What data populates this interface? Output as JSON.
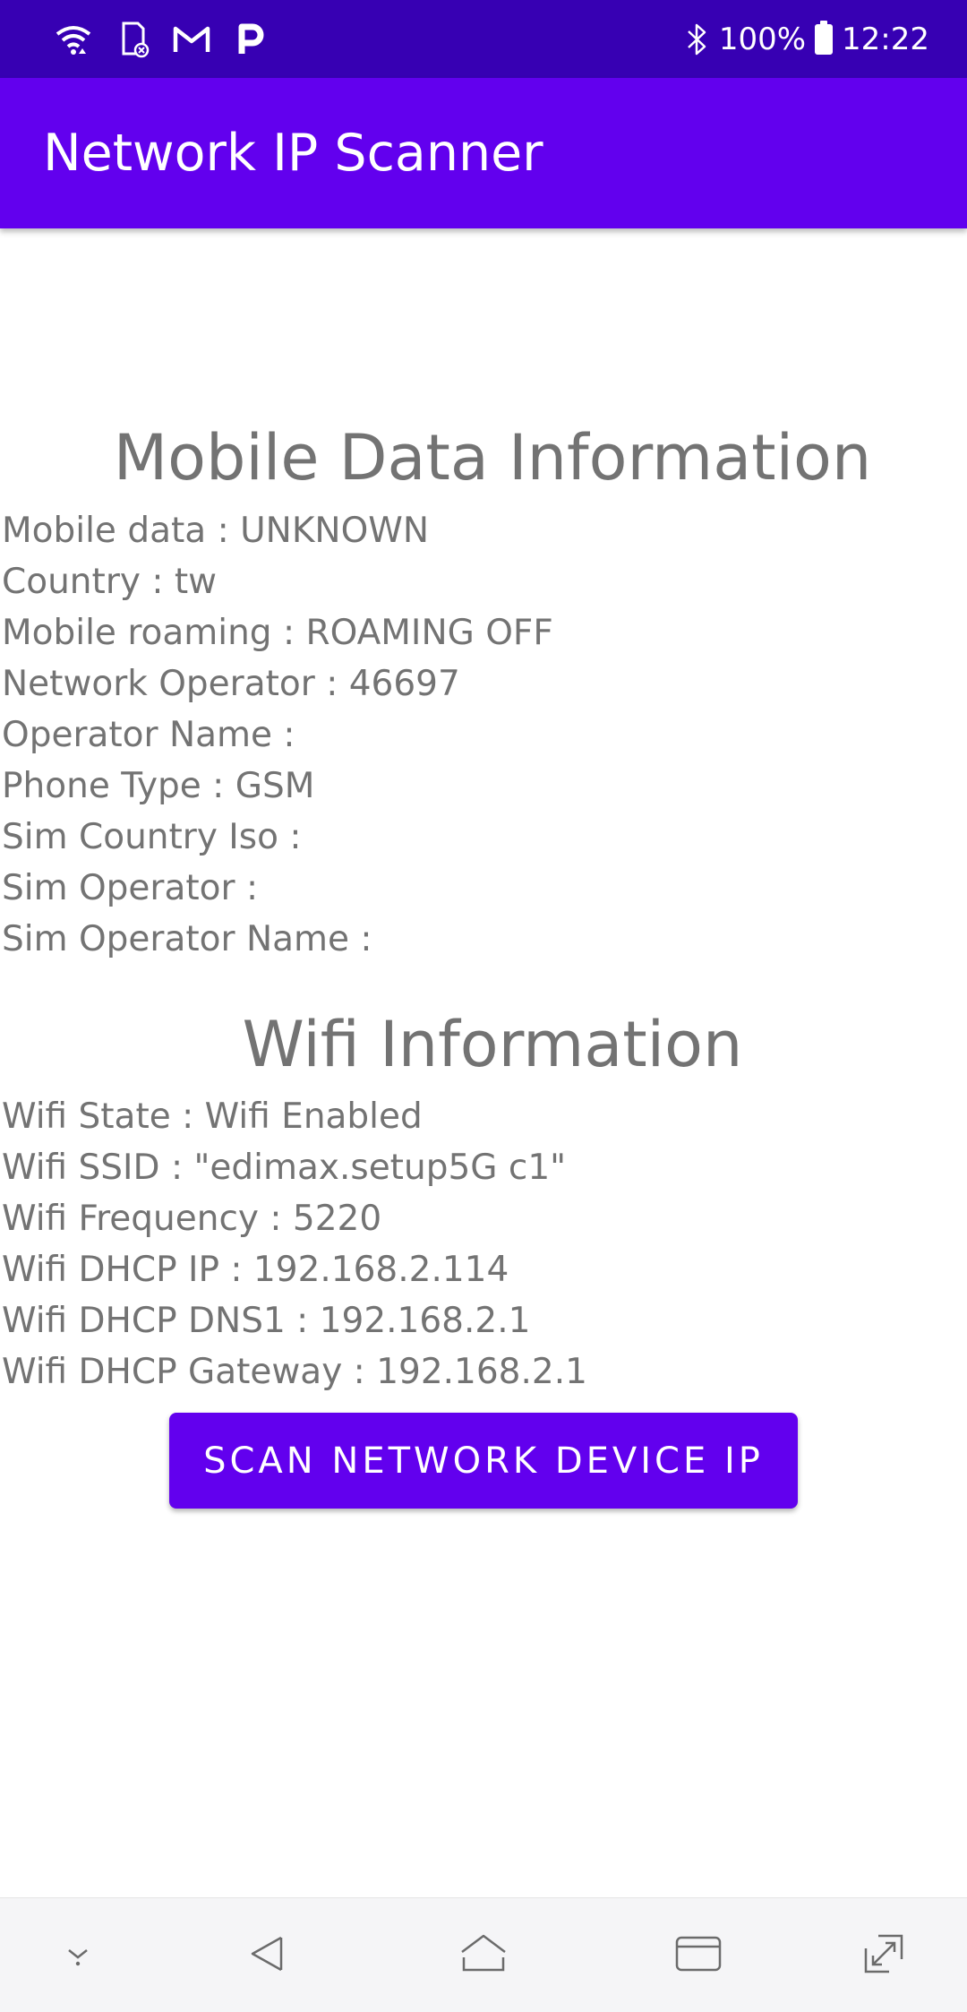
{
  "status_bar": {
    "battery_text": "100%",
    "time": "12:22",
    "icons": [
      "wifi-icon",
      "sd-card-icon",
      "gmail-icon",
      "p-app-icon",
      "bluetooth-icon",
      "battery-icon"
    ]
  },
  "app_bar": {
    "title": "Network IP Scanner"
  },
  "mobile_section": {
    "title": "Mobile Data Information",
    "lines": [
      "Mobile data : UNKNOWN",
      "Country : tw",
      "Mobile roaming : ROAMING OFF",
      "Network Operator : 46697",
      "Operator Name :",
      "Phone Type : GSM",
      "Sim Country Iso :",
      "Sim Operator :",
      "Sim Operator Name :"
    ]
  },
  "wifi_section": {
    "title": "Wifi Information",
    "lines": [
      "Wifi State : Wifi Enabled",
      "Wifi SSID : \"edimax.setup5G c1\"",
      "Wifi Frequency : 5220",
      "Wifi DHCP IP : 192.168.2.114",
      "Wifi DHCP DNS1 : 192.168.2.1",
      "Wifi DHCP Gateway : 192.168.2.1"
    ]
  },
  "scan_button": {
    "label": "SCAN NETWORK DEVICE IP"
  },
  "nav_bar": {
    "buttons": [
      "hide-nav-icon",
      "back-icon",
      "home-icon",
      "recents-icon",
      "screen-mode-icon"
    ]
  },
  "colors": {
    "status_bar": "#3700b3",
    "primary": "#6200ee",
    "text_gray": "#737373"
  }
}
